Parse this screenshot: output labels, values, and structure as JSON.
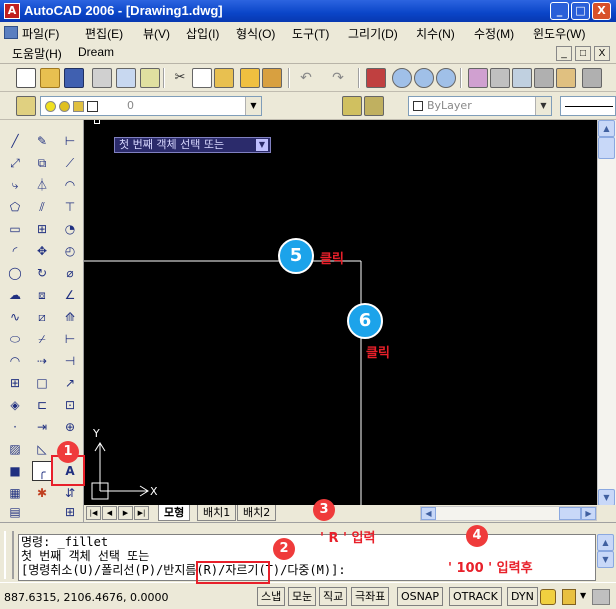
{
  "window": {
    "app_icon": "autocad-logo-icon",
    "title": "AutoCAD 2006 - [Drawing1.dwg]",
    "buttons": {
      "minimize": "_",
      "maximize": "□",
      "close": "X"
    },
    "inner_buttons": {
      "minimize": "_",
      "restore": "□",
      "close": "X"
    }
  },
  "menubar": {
    "row1": [
      "파일(F)",
      "편집(E)",
      "뷰(V)",
      "삽입(I)",
      "형식(O)",
      "도구(T)",
      "그리기(D)",
      "치수(N)",
      "수정(M)",
      "윈도우(W)"
    ],
    "row2": [
      "도움말(H)",
      "Dream"
    ]
  },
  "toolbar_layers": {
    "layer_value": "0",
    "color_value": "ByLayer"
  },
  "drawing": {
    "tooltip_text": "첫 번째 객체 선택 또는",
    "axis_y": "Y",
    "axis_x": "X"
  },
  "layout_tabs": [
    "모형",
    "배치1",
    "배치2"
  ],
  "command_lines": [
    "명령: _fillet",
    "첫 번째 객체 선택 또는",
    "[명령취소(U)/폴리선(P)/반지름(R)/자르기(T)/다중(M)]:"
  ],
  "status": {
    "coordinates": "887.6315, 2106.4676, 0.0000",
    "toggles": [
      "스냅",
      "모눈",
      "직교",
      "극좌표",
      "OSNAP",
      "OTRACK",
      "DYN"
    ]
  },
  "annotations": {
    "badges": [
      "1",
      "2",
      "3",
      "4",
      "5",
      "6"
    ],
    "note_r": "' R ' 입력",
    "note_100": "' 100 ' 입력후",
    "click_label_5": "클릭",
    "click_label_6": "클릭"
  },
  "colors": {
    "title_blue": "#0a45c8",
    "badge_red": "#ef3b3b",
    "badge_blue": "#1ca3ea",
    "note_red": "#e8202a"
  }
}
